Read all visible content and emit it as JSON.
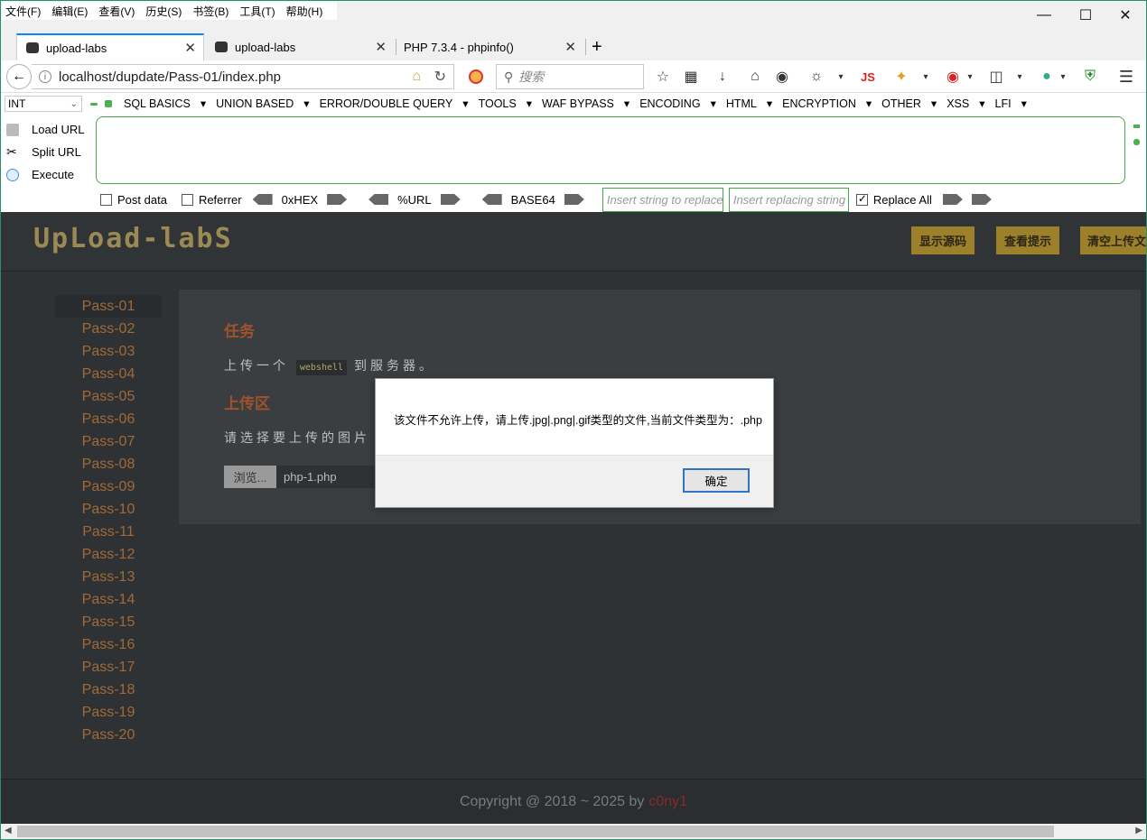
{
  "menubar": {
    "items": [
      "文件(F)",
      "编辑(E)",
      "查看(V)",
      "历史(S)",
      "书签(B)",
      "工具(T)",
      "帮助(H)"
    ]
  },
  "tabs": [
    {
      "label": "upload-labs",
      "active": true
    },
    {
      "label": "upload-labs",
      "active": false
    },
    {
      "label": "PHP 7.3.4 - phpinfo()",
      "active": false
    }
  ],
  "nav": {
    "url": "localhost/dupdate/Pass-01/index.php",
    "search_placeholder": "搜索"
  },
  "hackbar": {
    "select_value": "INT",
    "menus": [
      "SQL BASICS",
      "UNION BASED",
      "ERROR/DOUBLE QUERY",
      "TOOLS",
      "WAF BYPASS",
      "ENCODING",
      "HTML",
      "ENCRYPTION",
      "OTHER",
      "XSS",
      "LFI"
    ],
    "load_url": "Load URL",
    "split_url": "Split URL",
    "execute": "Execute",
    "post_data": "Post data",
    "referrer": "Referrer",
    "hex": "0xHEX",
    "url_enc": "%URL",
    "base64": "BASE64",
    "insert_placeholder": "Insert string to replace",
    "replacing_placeholder": "Insert replacing string",
    "replace_all": "Replace All"
  },
  "page": {
    "logo": "UpLoad-labS",
    "buttons": [
      "显示源码",
      "查看提示",
      "清空上传文"
    ],
    "sidebar": [
      "Pass-01",
      "Pass-02",
      "Pass-03",
      "Pass-04",
      "Pass-05",
      "Pass-06",
      "Pass-07",
      "Pass-08",
      "Pass-09",
      "Pass-10",
      "Pass-11",
      "Pass-12",
      "Pass-13",
      "Pass-14",
      "Pass-15",
      "Pass-16",
      "Pass-17",
      "Pass-18",
      "Pass-19",
      "Pass-20"
    ],
    "task_title": "任务",
    "task_desc_pre": "上传一个",
    "task_desc_code": "webshell",
    "task_desc_post": "到服务器。",
    "upload_title": "上传区",
    "upload_desc": "请选择要上传的图片",
    "browse": "浏览...",
    "filename": "php-1.php",
    "footer_text": "Copyright @ 2018 ~ 2025 by",
    "footer_author": "c0ny1"
  },
  "dialog": {
    "message": "该文件不允许上传，请上传.jpg|.png|.gif类型的文件,当前文件类型为：.php",
    "ok": "确定"
  }
}
